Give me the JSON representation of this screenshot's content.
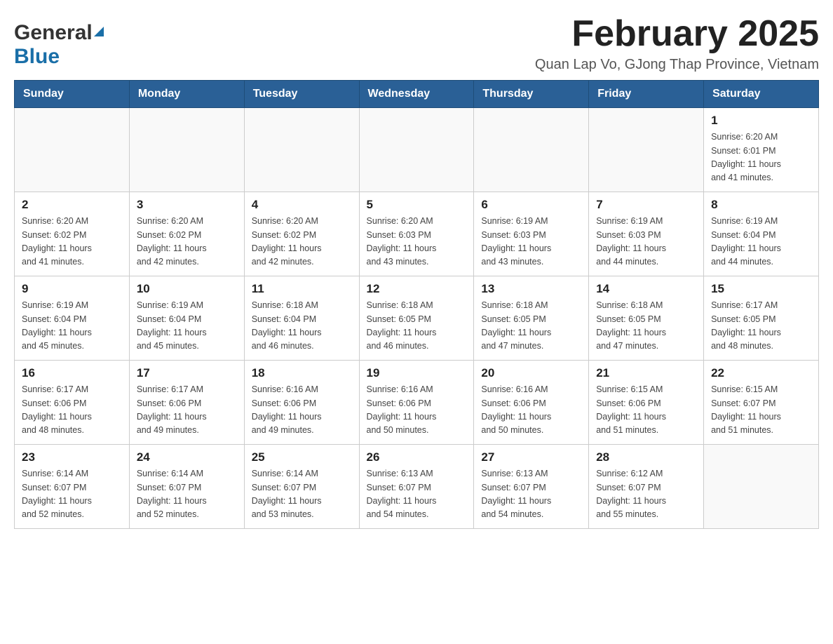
{
  "header": {
    "logo_general": "General",
    "logo_blue": "Blue",
    "title": "February 2025",
    "subtitle": "Quan Lap Vo, GJong Thap Province, Vietnam"
  },
  "days_of_week": [
    "Sunday",
    "Monday",
    "Tuesday",
    "Wednesday",
    "Thursday",
    "Friday",
    "Saturday"
  ],
  "weeks": [
    [
      {
        "day": "",
        "info": ""
      },
      {
        "day": "",
        "info": ""
      },
      {
        "day": "",
        "info": ""
      },
      {
        "day": "",
        "info": ""
      },
      {
        "day": "",
        "info": ""
      },
      {
        "day": "",
        "info": ""
      },
      {
        "day": "1",
        "info": "Sunrise: 6:20 AM\nSunset: 6:01 PM\nDaylight: 11 hours\nand 41 minutes."
      }
    ],
    [
      {
        "day": "2",
        "info": "Sunrise: 6:20 AM\nSunset: 6:02 PM\nDaylight: 11 hours\nand 41 minutes."
      },
      {
        "day": "3",
        "info": "Sunrise: 6:20 AM\nSunset: 6:02 PM\nDaylight: 11 hours\nand 42 minutes."
      },
      {
        "day": "4",
        "info": "Sunrise: 6:20 AM\nSunset: 6:02 PM\nDaylight: 11 hours\nand 42 minutes."
      },
      {
        "day": "5",
        "info": "Sunrise: 6:20 AM\nSunset: 6:03 PM\nDaylight: 11 hours\nand 43 minutes."
      },
      {
        "day": "6",
        "info": "Sunrise: 6:19 AM\nSunset: 6:03 PM\nDaylight: 11 hours\nand 43 minutes."
      },
      {
        "day": "7",
        "info": "Sunrise: 6:19 AM\nSunset: 6:03 PM\nDaylight: 11 hours\nand 44 minutes."
      },
      {
        "day": "8",
        "info": "Sunrise: 6:19 AM\nSunset: 6:04 PM\nDaylight: 11 hours\nand 44 minutes."
      }
    ],
    [
      {
        "day": "9",
        "info": "Sunrise: 6:19 AM\nSunset: 6:04 PM\nDaylight: 11 hours\nand 45 minutes."
      },
      {
        "day": "10",
        "info": "Sunrise: 6:19 AM\nSunset: 6:04 PM\nDaylight: 11 hours\nand 45 minutes."
      },
      {
        "day": "11",
        "info": "Sunrise: 6:18 AM\nSunset: 6:04 PM\nDaylight: 11 hours\nand 46 minutes."
      },
      {
        "day": "12",
        "info": "Sunrise: 6:18 AM\nSunset: 6:05 PM\nDaylight: 11 hours\nand 46 minutes."
      },
      {
        "day": "13",
        "info": "Sunrise: 6:18 AM\nSunset: 6:05 PM\nDaylight: 11 hours\nand 47 minutes."
      },
      {
        "day": "14",
        "info": "Sunrise: 6:18 AM\nSunset: 6:05 PM\nDaylight: 11 hours\nand 47 minutes."
      },
      {
        "day": "15",
        "info": "Sunrise: 6:17 AM\nSunset: 6:05 PM\nDaylight: 11 hours\nand 48 minutes."
      }
    ],
    [
      {
        "day": "16",
        "info": "Sunrise: 6:17 AM\nSunset: 6:06 PM\nDaylight: 11 hours\nand 48 minutes."
      },
      {
        "day": "17",
        "info": "Sunrise: 6:17 AM\nSunset: 6:06 PM\nDaylight: 11 hours\nand 49 minutes."
      },
      {
        "day": "18",
        "info": "Sunrise: 6:16 AM\nSunset: 6:06 PM\nDaylight: 11 hours\nand 49 minutes."
      },
      {
        "day": "19",
        "info": "Sunrise: 6:16 AM\nSunset: 6:06 PM\nDaylight: 11 hours\nand 50 minutes."
      },
      {
        "day": "20",
        "info": "Sunrise: 6:16 AM\nSunset: 6:06 PM\nDaylight: 11 hours\nand 50 minutes."
      },
      {
        "day": "21",
        "info": "Sunrise: 6:15 AM\nSunset: 6:06 PM\nDaylight: 11 hours\nand 51 minutes."
      },
      {
        "day": "22",
        "info": "Sunrise: 6:15 AM\nSunset: 6:07 PM\nDaylight: 11 hours\nand 51 minutes."
      }
    ],
    [
      {
        "day": "23",
        "info": "Sunrise: 6:14 AM\nSunset: 6:07 PM\nDaylight: 11 hours\nand 52 minutes."
      },
      {
        "day": "24",
        "info": "Sunrise: 6:14 AM\nSunset: 6:07 PM\nDaylight: 11 hours\nand 52 minutes."
      },
      {
        "day": "25",
        "info": "Sunrise: 6:14 AM\nSunset: 6:07 PM\nDaylight: 11 hours\nand 53 minutes."
      },
      {
        "day": "26",
        "info": "Sunrise: 6:13 AM\nSunset: 6:07 PM\nDaylight: 11 hours\nand 54 minutes."
      },
      {
        "day": "27",
        "info": "Sunrise: 6:13 AM\nSunset: 6:07 PM\nDaylight: 11 hours\nand 54 minutes."
      },
      {
        "day": "28",
        "info": "Sunrise: 6:12 AM\nSunset: 6:07 PM\nDaylight: 11 hours\nand 55 minutes."
      },
      {
        "day": "",
        "info": ""
      }
    ]
  ]
}
